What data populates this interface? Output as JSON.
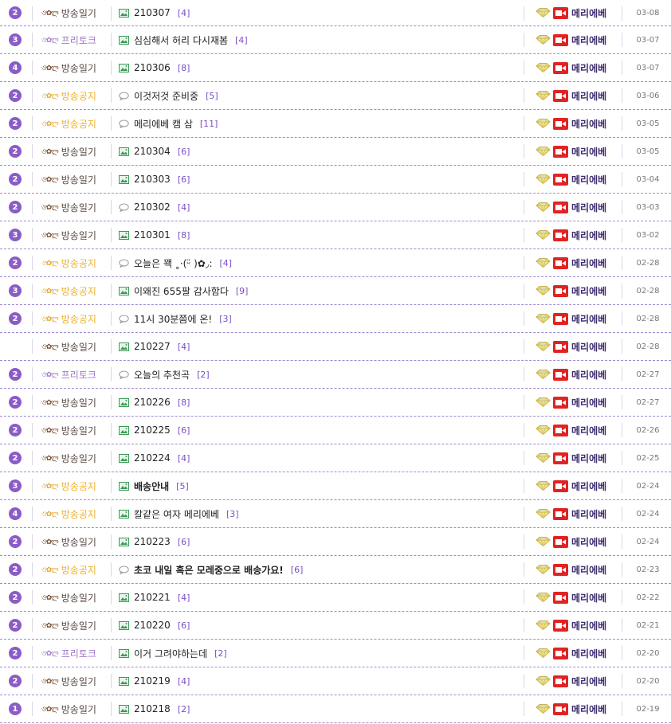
{
  "colors": {
    "accent": "#8a5cc7",
    "divider": "#9c8ad3",
    "notice": "#efb22b",
    "free": "#a27ac8",
    "count": "#7b4fc4",
    "camera": "#e02323"
  },
  "categories": {
    "diary": {
      "label": "방송일기",
      "emote": "ও✿ლ",
      "icon": "image-icon"
    },
    "notice": {
      "label": "방송공지",
      "emote": "ও✿ლ",
      "icon": "chat-icon"
    },
    "free": {
      "label": "프리토크",
      "emote": "ও✿ლ",
      "icon": "image-icon"
    }
  },
  "posts": [
    {
      "badge": "2",
      "cat": "diary",
      "cat_label": "방송일기",
      "emote": "ও✿ლ",
      "icon": "image",
      "title": "210307",
      "count": "[4]",
      "author": "메리에베",
      "date": "03-08",
      "bold": false
    },
    {
      "badge": "3",
      "cat": "free",
      "cat_label": "프리토크",
      "emote": "ও✿ლ",
      "icon": "image",
      "title": "심심해서 허리 다시재봄",
      "count": "[4]",
      "author": "메리에베",
      "date": "03-07",
      "bold": false
    },
    {
      "badge": "4",
      "cat": "diary",
      "cat_label": "방송일기",
      "emote": "ও✿ლ",
      "icon": "image",
      "title": "210306",
      "count": "[8]",
      "author": "메리에베",
      "date": "03-07",
      "bold": false
    },
    {
      "badge": "2",
      "cat": "notice",
      "cat_label": "방송공지",
      "emote": "ও✿ლ",
      "icon": "chat",
      "title": "이것저것 준비중",
      "count": "[5]",
      "author": "메리에베",
      "date": "03-06",
      "bold": false
    },
    {
      "badge": "2",
      "cat": "notice",
      "cat_label": "방송공지",
      "emote": "ও✿ლ",
      "icon": "chat",
      "title": "메리에베 캠 삼",
      "count": "[11]",
      "author": "메리에베",
      "date": "03-05",
      "bold": false
    },
    {
      "badge": "2",
      "cat": "diary",
      "cat_label": "방송일기",
      "emote": "ও✿ლ",
      "icon": "image",
      "title": "210304",
      "count": "[6]",
      "author": "메리에베",
      "date": "03-05",
      "bold": false
    },
    {
      "badge": "2",
      "cat": "diary",
      "cat_label": "방송일기",
      "emote": "ও✿ლ",
      "icon": "image",
      "title": "210303",
      "count": "[6]",
      "author": "메리에베",
      "date": "03-04",
      "bold": false
    },
    {
      "badge": "2",
      "cat": "diary",
      "cat_label": "방송일기",
      "emote": "ও✿ლ",
      "icon": "chat",
      "title": "210302",
      "count": "[4]",
      "author": "메리에베",
      "date": "03-03",
      "bold": false
    },
    {
      "badge": "3",
      "cat": "diary",
      "cat_label": "방송일기",
      "emote": "ও✿ლ",
      "icon": "image",
      "title": "210301",
      "count": "[8]",
      "author": "메리에베",
      "date": "03-02",
      "bold": false
    },
    {
      "badge": "2",
      "cat": "notice",
      "cat_label": "방송공지",
      "emote": "ও✿ლ",
      "icon": "chat",
      "title": "오늘은 꽥 ˳·(ᵕ̈ )✿◞:",
      "count": "[4]",
      "author": "메리에베",
      "date": "02-28",
      "bold": false
    },
    {
      "badge": "3",
      "cat": "notice",
      "cat_label": "방송공지",
      "emote": "ও✿ლ",
      "icon": "image",
      "title": "이왜진 655팔 감사함다",
      "count": "[9]",
      "author": "메리에베",
      "date": "02-28",
      "bold": false
    },
    {
      "badge": "2",
      "cat": "notice",
      "cat_label": "방송공지",
      "emote": "ও✿ლ",
      "icon": "chat",
      "title": "11시 30분쯤에 온!",
      "count": "[3]",
      "author": "메리에베",
      "date": "02-28",
      "bold": false
    },
    {
      "badge": "",
      "cat": "diary",
      "cat_label": "방송일기",
      "emote": "ও✿ლ",
      "icon": "image",
      "title": "210227",
      "count": "[4]",
      "author": "메리에베",
      "date": "02-28",
      "bold": false
    },
    {
      "badge": "2",
      "cat": "free",
      "cat_label": "프리토크",
      "emote": "ও✿ლ",
      "icon": "chat",
      "title": "오늘의 추천곡",
      "count": "[2]",
      "author": "메리에베",
      "date": "02-27",
      "bold": false
    },
    {
      "badge": "2",
      "cat": "diary",
      "cat_label": "방송일기",
      "emote": "ও✿ლ",
      "icon": "image",
      "title": "210226",
      "count": "[8]",
      "author": "메리에베",
      "date": "02-27",
      "bold": false
    },
    {
      "badge": "2",
      "cat": "diary",
      "cat_label": "방송일기",
      "emote": "ও✿ლ",
      "icon": "image",
      "title": "210225",
      "count": "[6]",
      "author": "메리에베",
      "date": "02-26",
      "bold": false
    },
    {
      "badge": "2",
      "cat": "diary",
      "cat_label": "방송일기",
      "emote": "ও✿ლ",
      "icon": "image",
      "title": "210224",
      "count": "[4]",
      "author": "메리에베",
      "date": "02-25",
      "bold": false
    },
    {
      "badge": "3",
      "cat": "notice",
      "cat_label": "방송공지",
      "emote": "ও✿ლ",
      "icon": "image",
      "title": "배송안내",
      "count": "[5]",
      "author": "메리에베",
      "date": "02-24",
      "bold": true
    },
    {
      "badge": "4",
      "cat": "notice",
      "cat_label": "방송공지",
      "emote": "ও✿ლ",
      "icon": "image",
      "title": "칼같은 여자 메리에베",
      "count": "[3]",
      "author": "메리에베",
      "date": "02-24",
      "bold": false
    },
    {
      "badge": "2",
      "cat": "diary",
      "cat_label": "방송일기",
      "emote": "ও✿ლ",
      "icon": "image",
      "title": "210223",
      "count": "[6]",
      "author": "메리에베",
      "date": "02-24",
      "bold": false
    },
    {
      "badge": "2",
      "cat": "notice",
      "cat_label": "방송공지",
      "emote": "ও✿ლ",
      "icon": "chat",
      "title": "초코 내일 혹은 모레중으로 배송가요!",
      "count": "[6]",
      "author": "메리에베",
      "date": "02-23",
      "bold": true
    },
    {
      "badge": "2",
      "cat": "diary",
      "cat_label": "방송일기",
      "emote": "ও✿ლ",
      "icon": "image",
      "title": "210221",
      "count": "[4]",
      "author": "메리에베",
      "date": "02-22",
      "bold": false
    },
    {
      "badge": "2",
      "cat": "diary",
      "cat_label": "방송일기",
      "emote": "ও✿ლ",
      "icon": "image",
      "title": "210220",
      "count": "[6]",
      "author": "메리에베",
      "date": "02-21",
      "bold": false
    },
    {
      "badge": "2",
      "cat": "free",
      "cat_label": "프리토크",
      "emote": "ও✿ლ",
      "icon": "image",
      "title": "이거 그려야하는데",
      "count": "[2]",
      "author": "메리에베",
      "date": "02-20",
      "bold": false
    },
    {
      "badge": "2",
      "cat": "diary",
      "cat_label": "방송일기",
      "emote": "ও✿ლ",
      "icon": "image",
      "title": "210219",
      "count": "[4]",
      "author": "메리에베",
      "date": "02-20",
      "bold": false
    },
    {
      "badge": "1",
      "cat": "diary",
      "cat_label": "방송일기",
      "emote": "ও✿ლ",
      "icon": "image",
      "title": "210218",
      "count": "[2]",
      "author": "메리에베",
      "date": "02-19",
      "bold": false
    }
  ]
}
